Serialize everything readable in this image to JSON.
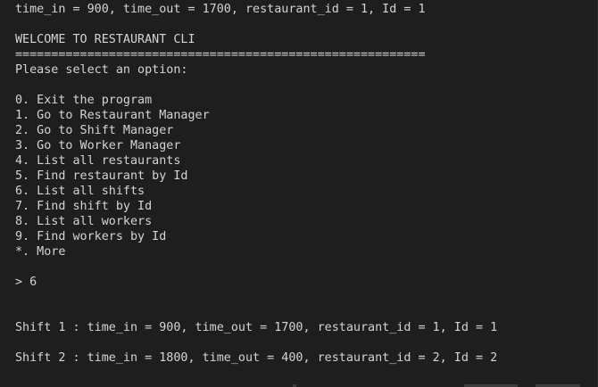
{
  "terminal": {
    "lines": {
      "l0": "time_in = 900, time_out = 1700, restaurant_id = 1, Id = 1",
      "l1": "",
      "l2": "WELCOME TO RESTAURANT CLI",
      "l3": "=========================================================",
      "l4": "Please select an option:",
      "l5": "",
      "l6": "0. Exit the program",
      "l7": "1. Go to Restaurant Manager",
      "l8": "2. Go to Shift Manager",
      "l9": "3. Go to Worker Manager",
      "l10": "4. List all restaurants",
      "l11": "5. Find restaurant by Id",
      "l12": "6. List all shifts",
      "l13": "7. Find shift by Id",
      "l14": "8. List all workers",
      "l15": "9. Find workers by Id",
      "l16": "*. More",
      "l17": "",
      "l18": "> 6",
      "l19": "",
      "l20": "",
      "l21": "Shift 1 : time_in = 900, time_out = 1700, restaurant_id = 1, Id = 1",
      "l22": "",
      "l23": "Shift 2 : time_in = 1800, time_out = 400, restaurant_id = 2, Id = 2"
    }
  }
}
